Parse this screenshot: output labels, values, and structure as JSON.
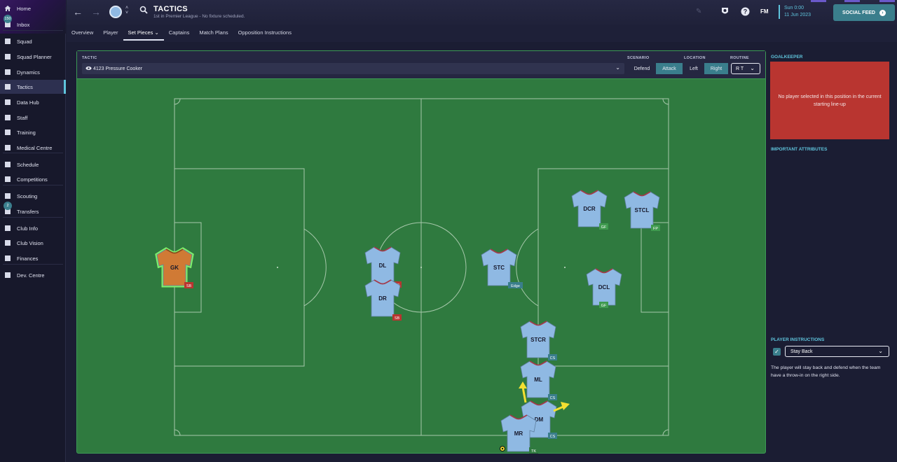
{
  "sidebar": {
    "items": [
      {
        "label": "Home",
        "icon": "home-icon"
      },
      {
        "label": "Inbox",
        "icon": "inbox-icon",
        "badge": "150"
      },
      {
        "label": "Squad",
        "icon": "squad-icon"
      },
      {
        "label": "Squad Planner",
        "icon": "planner-icon"
      },
      {
        "label": "Dynamics",
        "icon": "dynamics-icon"
      },
      {
        "label": "Tactics",
        "icon": "tactics-icon"
      },
      {
        "label": "Data Hub",
        "icon": "data-hub-icon"
      },
      {
        "label": "Staff",
        "icon": "staff-icon"
      },
      {
        "label": "Training",
        "icon": "training-icon"
      },
      {
        "label": "Medical Centre",
        "icon": "medical-icon"
      },
      {
        "label": "Schedule",
        "icon": "schedule-icon"
      },
      {
        "label": "Competitions",
        "icon": "trophy-icon"
      },
      {
        "label": "Scouting",
        "icon": "scouting-icon"
      },
      {
        "label": "Transfers",
        "icon": "transfers-icon",
        "badge": "2"
      },
      {
        "label": "Club Info",
        "icon": "club-info-icon"
      },
      {
        "label": "Club Vision",
        "icon": "club-vision-icon"
      },
      {
        "label": "Finances",
        "icon": "finances-icon"
      },
      {
        "label": "Dev. Centre",
        "icon": "dev-centre-icon"
      }
    ]
  },
  "header": {
    "title": "TACTICS",
    "subtitle": "1st in Premier League - No fixture scheduled.",
    "tabs": [
      "Overview",
      "Player",
      "Set Pieces ⌄",
      "Captains",
      "Match Plans",
      "Opposition Instructions"
    ],
    "active_tab": "Set Pieces",
    "date_line1": "Sun 0:00",
    "date_line2": "11 Jun 2023",
    "fm_label": "FM",
    "social_feed": "SOCIAL FEED"
  },
  "controls": {
    "tactic_label": "TACTIC",
    "tactic_value": "4123 Pressure Cooker",
    "scenario_label": "SCENARIO",
    "scenario_options": [
      "Defend",
      "Attack"
    ],
    "scenario_selected": "Attack",
    "location_label": "LOCATION",
    "location_options": [
      "Left",
      "Right"
    ],
    "location_selected": "Right",
    "routine_label": "ROUTINE",
    "routine_value": "R T"
  },
  "players": [
    {
      "pos": "GK",
      "tag": "SB",
      "tag_color": "#b93530",
      "kit": "#d07a35"
    },
    {
      "pos": "DL",
      "tag": "SB",
      "tag_color": "#b93530",
      "kit": "#8fb9e3"
    },
    {
      "pos": "DR",
      "tag": "SB",
      "tag_color": "#b93530",
      "kit": "#8fb9e3"
    },
    {
      "pos": "STC",
      "tag": "Edge",
      "tag_color": "#3a7e8c",
      "kit": "#8fb9e3"
    },
    {
      "pos": "DCR",
      "tag": "GF",
      "tag_color": "#3f9a4f",
      "kit": "#8fb9e3"
    },
    {
      "pos": "STCL",
      "tag": "FP",
      "tag_color": "#3f9a4f",
      "kit": "#8fb9e3"
    },
    {
      "pos": "DCL",
      "tag": "GF",
      "tag_color": "#3f9a4f",
      "kit": "#8fb9e3"
    },
    {
      "pos": "STCR",
      "tag": "CS",
      "tag_color": "#3a7e8c",
      "kit": "#8fb9e3"
    },
    {
      "pos": "ML",
      "tag": "CS",
      "tag_color": "#3a7e8c",
      "kit": "#8fb9e3"
    },
    {
      "pos": "DM",
      "tag": "CS",
      "tag_color": "#3a7e8c",
      "kit": "#8fb9e3"
    },
    {
      "pos": "MR",
      "tag": "TK",
      "tag_color": "#2f7a3f",
      "kit": "#8fb9e3"
    }
  ],
  "right_panel": {
    "goalkeeper_title": "GOALKEEPER",
    "goalkeeper_message": "No player selected in this position in the current starting line-up",
    "attributes_title": "IMPORTANT ATTRIBUTES",
    "instructions_title": "PLAYER INSTRUCTIONS",
    "instruction_checked": true,
    "instruction_value": "Stay Back",
    "instruction_desc": "The player will stay back and defend when the team have a throw-in on the right side."
  }
}
